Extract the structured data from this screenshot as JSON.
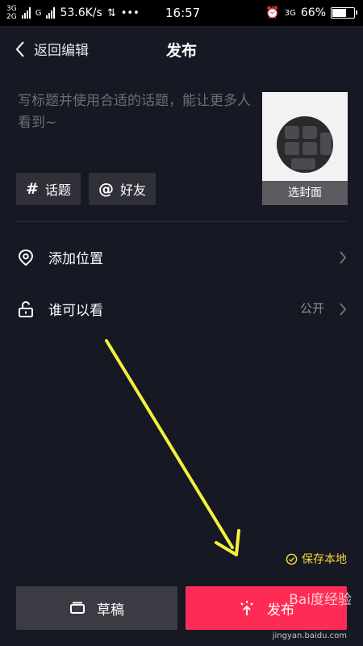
{
  "status_bar": {
    "net_top": "3G",
    "net_bottom": "2G",
    "net_g": "G",
    "speed": "53.6K/s",
    "time": "16:57",
    "net_right": "3G",
    "battery": "66%",
    "battery_level": 0.66
  },
  "header": {
    "back_label": "返回编辑",
    "title": "发布"
  },
  "caption": {
    "placeholder": "写标题并使用合适的话题，能让更多人看到~"
  },
  "cover": {
    "label": "选封面"
  },
  "chips": [
    {
      "symbol": "#",
      "label": "话题"
    },
    {
      "symbol": "@",
      "label": "好友"
    }
  ],
  "rows": [
    {
      "label": "添加位置",
      "value": ""
    },
    {
      "label": "谁可以看",
      "value": "公开"
    }
  ],
  "save_local": {
    "label": "保存本地",
    "checked": true
  },
  "buttons": {
    "draft": "草稿",
    "publish": "发布"
  },
  "watermark": {
    "text": "Bai度经验",
    "url": "jingyan.baidu.com"
  },
  "colors": {
    "background": "#161823",
    "publish": "#fe2c55",
    "draft": "#3a3b43",
    "accent": "#f9d53d"
  }
}
